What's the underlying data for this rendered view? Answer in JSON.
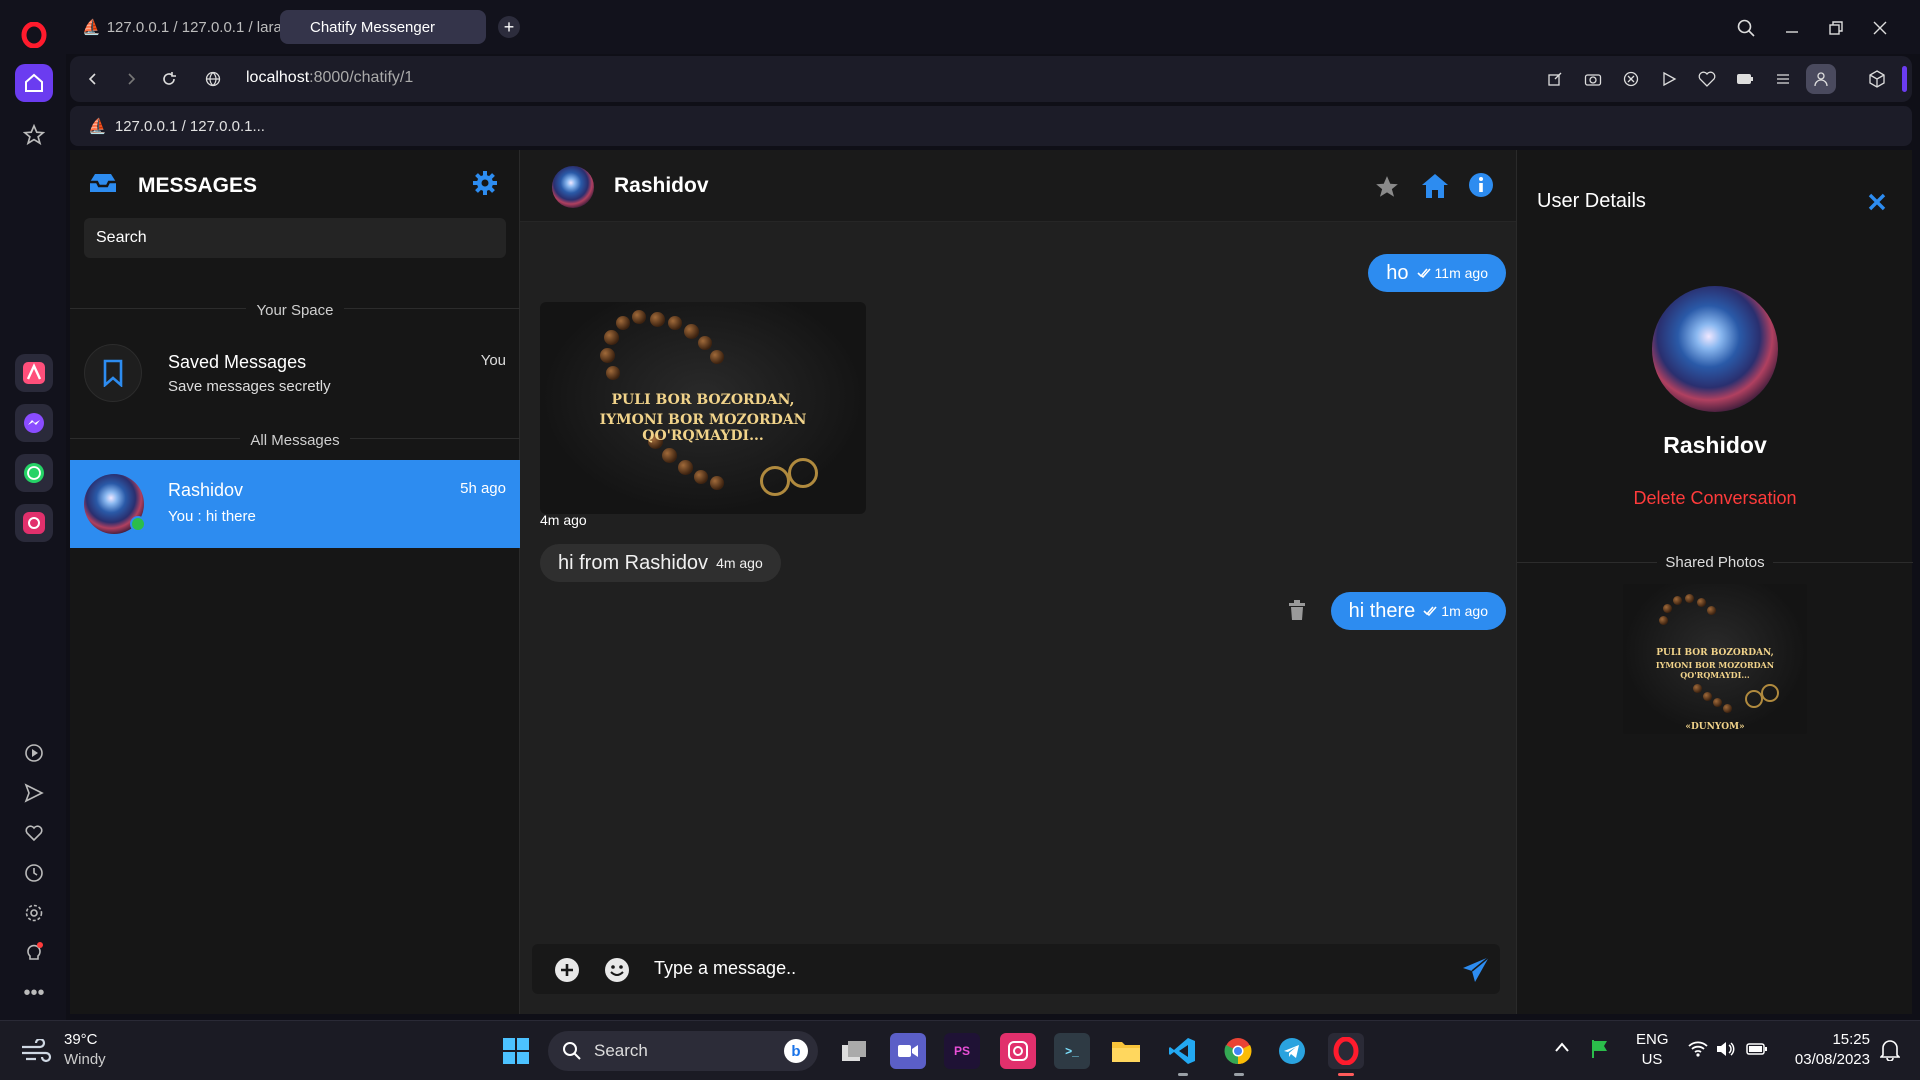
{
  "browser": {
    "tabs": [
      {
        "label": "127.0.0.1 / 127.0.0.1 / lara"
      },
      {
        "label": "Chatify Messenger"
      }
    ],
    "address": {
      "host": "localhost",
      "rest": ":8000/chatify/1"
    },
    "bookmark": "127.0.0.1 / 127.0.0.1..."
  },
  "sidebar": {
    "title": "MESSAGES",
    "search_placeholder": "Search",
    "your_space": "Your Space",
    "saved": {
      "title": "Saved Messages",
      "subtitle": "Save messages secretly",
      "badge": "You"
    },
    "all_messages": "All Messages",
    "contacts": [
      {
        "name": "Rashidov",
        "preview": "You : hi there",
        "time": "5h ago",
        "online": true
      }
    ]
  },
  "chat": {
    "header_name": "Rashidov",
    "messages": [
      {
        "dir": "out",
        "text": "ho",
        "time": "11m ago"
      },
      {
        "dir": "in-image",
        "caption_line1": "PULI BOR BOZORDAN,",
        "caption_line2": "IYMONI BOR MOZORDAN QO'RQMAYDI...",
        "time": "4m ago"
      },
      {
        "dir": "in",
        "text": "hi from Rashidov",
        "time": "4m ago"
      },
      {
        "dir": "out",
        "text": "hi there",
        "time": "1m ago"
      }
    ],
    "input_placeholder": "Type a message.."
  },
  "details": {
    "title": "User Details",
    "name": "Rashidov",
    "delete_label": "Delete Conversation",
    "shared_photos_label": "Shared Photos",
    "shared_photo_caption1": "PULI BOR BOZORDAN,",
    "shared_photo_caption2": "IYMONI BOR MOZORDAN QO'RQMAYDI...",
    "shared_photo_footer": "«DUNYOM»"
  },
  "taskbar": {
    "weather_temp": "39°C",
    "weather_desc": "Windy",
    "search_label": "Search",
    "lang1": "ENG",
    "lang2": "US",
    "time": "15:25",
    "date": "03/08/2023"
  },
  "colors": {
    "accent": "#2d8cf0",
    "danger": "#ff3b3b",
    "opera_red": "#ff1b2d"
  }
}
